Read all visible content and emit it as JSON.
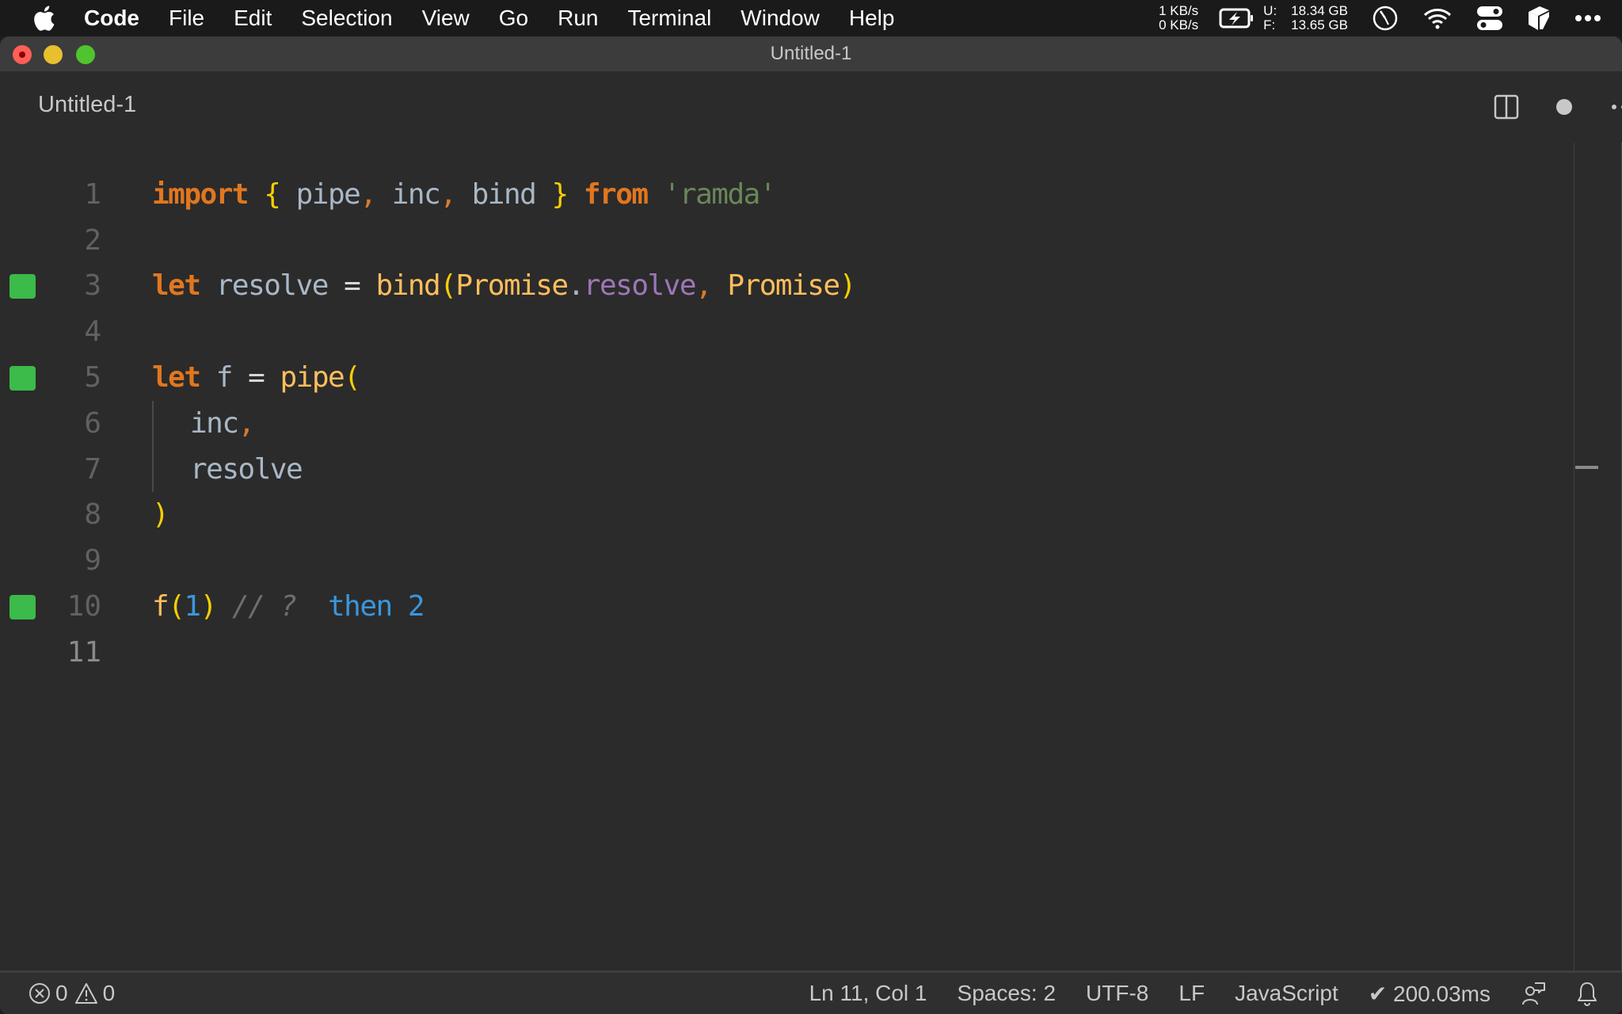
{
  "menubar": {
    "app_name": "Code",
    "items": [
      "File",
      "Edit",
      "Selection",
      "View",
      "Go",
      "Run",
      "Terminal",
      "Window",
      "Help"
    ],
    "network": {
      "up": "1 KB/s",
      "down": "0 KB/s"
    },
    "memory": {
      "used_label": "U:",
      "used": "18.34 GB",
      "free_label": "F:",
      "free": "13.65 GB"
    },
    "icons": [
      "apple-logo",
      "battery-charging",
      "clock",
      "wifi",
      "control-center",
      "app-indicator",
      "more"
    ]
  },
  "window": {
    "title": "Untitled-1",
    "controls": [
      "close",
      "minimize",
      "zoom"
    ]
  },
  "tab": {
    "label": "Untitled-1",
    "actions": [
      "split-editor",
      "unsaved-indicator",
      "more-actions"
    ]
  },
  "editor": {
    "language": "JavaScript",
    "lines": [
      {
        "n": "1",
        "marker": false
      },
      {
        "n": "2",
        "marker": false
      },
      {
        "n": "3",
        "marker": true
      },
      {
        "n": "4",
        "marker": false
      },
      {
        "n": "5",
        "marker": true
      },
      {
        "n": "6",
        "marker": false
      },
      {
        "n": "7",
        "marker": false
      },
      {
        "n": "8",
        "marker": false
      },
      {
        "n": "9",
        "marker": false
      },
      {
        "n": "10",
        "marker": true
      },
      {
        "n": "11",
        "marker": false,
        "current": true
      }
    ],
    "tokens": {
      "l1": {
        "import": "import",
        "ob": "{",
        "pipe": "pipe",
        "c1": ",",
        "inc": "inc",
        "c2": ",",
        "bind": "bind",
        "cb": "}",
        "from": "from",
        "mod": "'ramda'"
      },
      "l3": {
        "let": "let",
        "name": "resolve",
        "eq": "=",
        "fn": "bind",
        "op": "(",
        "obj1": "Promise",
        "dot": ".",
        "prop": "resolve",
        "comma": ",",
        "obj2": "Promise",
        "cp": ")"
      },
      "l5": {
        "let": "let",
        "name": "f",
        "eq": "=",
        "fn": "pipe",
        "op": "("
      },
      "l6": {
        "arg": "inc",
        "comma": ","
      },
      "l7": {
        "arg": "resolve"
      },
      "l8": {
        "cp": ")"
      },
      "l10": {
        "fn": "f",
        "op": "(",
        "num": "1",
        "cp": ")",
        "comment": "// ?",
        "result": "then 2"
      }
    }
  },
  "statusbar": {
    "errors": "0",
    "warnings": "0",
    "position": "Ln 11, Col 1",
    "spaces": "Spaces: 2",
    "encoding": "UTF-8",
    "eol": "LF",
    "language": "JavaScript",
    "timing": "✔ 200.03ms"
  }
}
